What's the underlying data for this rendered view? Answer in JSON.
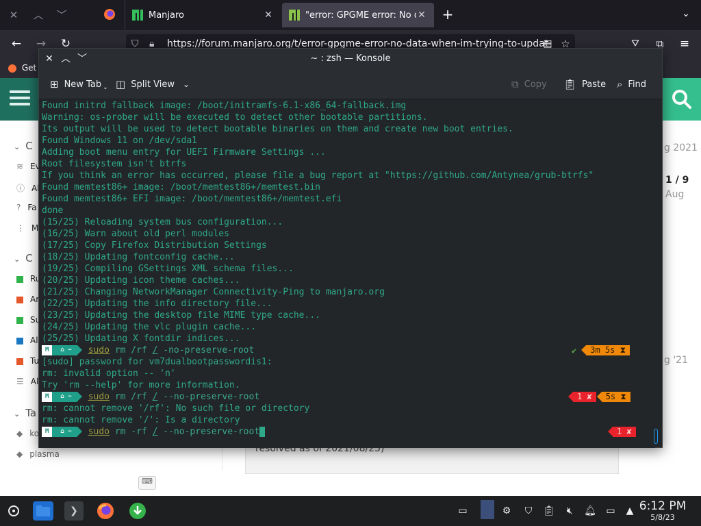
{
  "browser": {
    "tabs": [
      {
        "label": "Manjaro",
        "active": false
      },
      {
        "label": "\"error: GPGME error: No d",
        "active": true
      }
    ],
    "url": "https://forum.manjaro.org/t/error-gpgme-error-no-data-when-im-trying-to-updat",
    "bookmark": "Get"
  },
  "forum": {
    "sidebar_heads": [
      "C",
      "C",
      "Ta"
    ],
    "sidebar_items": [
      "Ev",
      "Al",
      "Fa",
      "M"
    ],
    "categories": [
      {
        "label": "Ru",
        "color": "#2fb34a"
      },
      {
        "label": "Ar",
        "color": "#e4582b"
      },
      {
        "label": "Su",
        "color": "#2fb34a"
      },
      {
        "label": "Al",
        "color": "#1a78c2"
      },
      {
        "label": "Tu",
        "color": "#e4582b"
      },
      {
        "label": "Al",
        "color": "#555555"
      }
    ],
    "tags": [
      "ko",
      "plasma"
    ],
    "right_date1": "g 2021",
    "right_counter": "1 / 9",
    "right_aug": "Aug",
    "right_date2": "g '21",
    "post_text": "resolved as of 2021/08/25)"
  },
  "konsole": {
    "title": "~ : zsh — Konsole",
    "toolbar": {
      "new_tab": "New Tab",
      "split_view": "Split View",
      "copy": "Copy",
      "paste": "Paste",
      "find": "Find"
    },
    "output_lines": [
      "Found initrd fallback image: /boot/initramfs-6.1-x86_64-fallback.img",
      "Warning: os-prober will be executed to detect other bootable partitions.",
      "Its output will be used to detect bootable binaries on them and create new boot entries.",
      "Found Windows 11 on /dev/sda1",
      "Adding boot menu entry for UEFI Firmware Settings ...",
      "Root filesystem isn't btrfs",
      "If you think an error has occurred, please file a bug report at \"https://github.com/Antynea/grub-btrfs\"",
      "Found memtest86+ image: /boot/memtest86+/memtest.bin",
      "Found memtest86+ EFI image: /boot/memtest86+/memtest.efi",
      "done",
      "(15/25) Reloading system bus configuration...",
      "(16/25) Warn about old perl modules",
      "(17/25) Copy Firefox Distribution Settings",
      "(18/25) Updating fontconfig cache...",
      "(19/25) Compiling GSettings XML schema files...",
      "(20/25) Updating icon theme caches...",
      "(21/25) Changing NetworkManager Connectivity-Ping to manjaro.org",
      "(22/25) Updating the info directory file...",
      "(23/25) Updating the desktop file MIME type cache...",
      "(24/25) Updating the vlc plugin cache...",
      "(25/25) Updating X fontdir indices..."
    ],
    "prompt1": {
      "seg1": "M",
      "seg2": "⌂ ~",
      "sudo": "sudo",
      "rest_a": " rm /rf ",
      "slash": "/",
      "rest_b": " -no-preserve-root",
      "check": "✔",
      "time": "3m 5s ⧗"
    },
    "block1": [
      "[sudo] password for vm7dualbootpasswordis1:",
      "rm: invalid option -- 'n'",
      "Try 'rm --help' for more information."
    ],
    "prompt2": {
      "seg1": "M",
      "seg2": "⌂ ~",
      "sudo": "sudo",
      "rest_a": " rm /rf ",
      "slash": "/",
      "rest_b": " --no-preserve-root",
      "err": "1 ✘",
      "time": "5s ⧗"
    },
    "block2": [
      "rm: cannot remove '/rf': No such file or directory",
      "rm: cannot remove '/': Is a directory"
    ],
    "prompt3": {
      "seg1": "M",
      "seg2": "⌂ ~",
      "sudo": "sudo",
      "rest_a": " rm -rf ",
      "slash": "/",
      "rest_b": " --no-preserve-root",
      "err": "1 ✘"
    }
  },
  "taskbar": {
    "time": "6:12 PM",
    "date": "5/8/23"
  }
}
